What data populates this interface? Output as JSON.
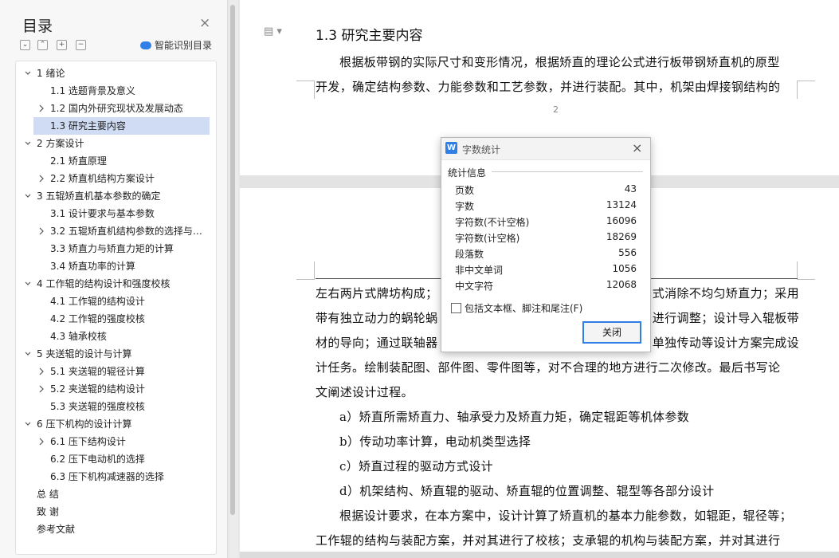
{
  "nav": {
    "title": "目录",
    "close_glyph": "×",
    "toolbar": [
      "⌄",
      "⌃",
      "+",
      "−"
    ],
    "smart_label": "智能识别目录",
    "items": [
      {
        "label": "1  绪论",
        "level": 1,
        "expander": "down",
        "selected": false
      },
      {
        "label": "1.1  选题背景及意义",
        "level": 2,
        "expander": "none",
        "selected": false
      },
      {
        "label": "1.2  国内外研究现状及发展动态",
        "level": 2,
        "expander": "right",
        "selected": false
      },
      {
        "label": "1.3  研究主要内容",
        "level": 2,
        "expander": "none",
        "selected": true
      },
      {
        "label": "2  方案设计",
        "level": 1,
        "expander": "down",
        "selected": false
      },
      {
        "label": "2.1  矫直原理",
        "level": 2,
        "expander": "none",
        "selected": false
      },
      {
        "label": "2.2  矫直机结构方案设计",
        "level": 2,
        "expander": "right",
        "selected": false
      },
      {
        "label": "3  五辊矫直机基本参数的确定",
        "level": 1,
        "expander": "down",
        "selected": false
      },
      {
        "label": "3.1  设计要求与基本参数",
        "level": 2,
        "expander": "none",
        "selected": false
      },
      {
        "label": "3.2  五辊矫直机结构参数的选择与…",
        "level": 2,
        "expander": "right",
        "selected": false
      },
      {
        "label": "3.3 矫直力与矫直力矩的计算",
        "level": 2,
        "expander": "none",
        "selected": false
      },
      {
        "label": "3.4  矫直功率的计算",
        "level": 2,
        "expander": "none",
        "selected": false
      },
      {
        "label": "4  工作辊的结构设计和强度校核",
        "level": 1,
        "expander": "down",
        "selected": false
      },
      {
        "label": "4.1 工作辊的结构设计",
        "level": 2,
        "expander": "none",
        "selected": false
      },
      {
        "label": "4.2 工作辊的强度校核",
        "level": 2,
        "expander": "none",
        "selected": false
      },
      {
        "label": "4.3 轴承校核",
        "level": 2,
        "expander": "none",
        "selected": false
      },
      {
        "label": "5  夹送辊的设计与计算",
        "level": 1,
        "expander": "down",
        "selected": false
      },
      {
        "label": "5.1  夹送辊的辊径计算",
        "level": 2,
        "expander": "right",
        "selected": false
      },
      {
        "label": "5.2  夹送辊的结构设计",
        "level": 2,
        "expander": "right",
        "selected": false
      },
      {
        "label": "5.3  夹送辊的强度校核",
        "level": 2,
        "expander": "none",
        "selected": false
      },
      {
        "label": "6  压下机构的设计计算",
        "level": 1,
        "expander": "down",
        "selected": false
      },
      {
        "label": "6.1 压下结构设计",
        "level": 2,
        "expander": "right",
        "selected": false
      },
      {
        "label": "6.2 压下电动机的选择",
        "level": 2,
        "expander": "none",
        "selected": false
      },
      {
        "label": "6.3 压下机构减速器的选择",
        "level": 2,
        "expander": "none",
        "selected": false
      },
      {
        "label": "总    结",
        "level": 0,
        "expander": "none",
        "selected": false
      },
      {
        "label": "致    谢",
        "level": 0,
        "expander": "none",
        "selected": false
      },
      {
        "label": "参考文献",
        "level": 0,
        "expander": "none",
        "selected": false
      }
    ]
  },
  "doc": {
    "page1": {
      "heading": "1.3  研究主要内容",
      "lines": [
        "根据板带钢的实际尺寸和变形情况，根据矫直的理论公式进行板带钢矫直机的原型",
        "开发，确定结构参数、力能参数和工艺参数，并进行装配。其中，机架由焊接钢结构的"
      ],
      "page_number": "2"
    },
    "page2": {
      "lines": [
        {
          "text": "左右两片式牌坊构成；",
          "right": "式消除不均匀矫直力；采用"
        },
        {
          "text": "带有独立动力的蜗轮蜗",
          "right": "进行调整；设计导入辊板带"
        },
        {
          "text": "材的导向；通过联轴器",
          "right": "单独传动等设计方案完成设"
        },
        {
          "text": "计任务。绘制装配图、部件图、零件图等，对不合理的地方进行二次修改。最后书写论",
          "right": ""
        },
        {
          "text": "文阐述设计过程。",
          "right": ""
        },
        {
          "text": "a）矫直所需矫直力、轴承受力及矫直力矩，确定辊距等机体参数",
          "right": ""
        },
        {
          "text": "b）传动功率计算，电动机类型选择",
          "right": ""
        },
        {
          "text": "c）矫直过程的驱动方式设计",
          "right": ""
        },
        {
          "text": "d）机架结构、矫直辊的驱动、矫直辊的位置调整、辊型等各部分设计",
          "right": ""
        },
        {
          "text": "根据设计要求，在本方案中，设计计算了矫直机的基本力能参数，如辊距，辊径等；",
          "right": ""
        },
        {
          "text": "工作辊的结构与装配方案，并对其进行了校核；支承辊的机构与装配方案，并对其进行",
          "right": ""
        }
      ]
    }
  },
  "dialog": {
    "title": "字数统计",
    "icon_text": "W",
    "close_glyph": "×",
    "group_label": "统计信息",
    "stats": [
      {
        "label": "页数",
        "value": "43"
      },
      {
        "label": "字数",
        "value": "13124"
      },
      {
        "label": "字符数(不计空格)",
        "value": "16096"
      },
      {
        "label": "字符数(计空格)",
        "value": "18269"
      },
      {
        "label": "段落数",
        "value": "556"
      },
      {
        "label": "非中文单词",
        "value": "1056"
      },
      {
        "label": "中文字符",
        "value": "12068"
      }
    ],
    "checkbox_label": "包括文本框、脚注和尾注(F)",
    "checkbox_checked": false,
    "close_button": "关闭"
  },
  "colors": {
    "accent": "#2f7fe6",
    "selection": "#cfdcf3"
  }
}
